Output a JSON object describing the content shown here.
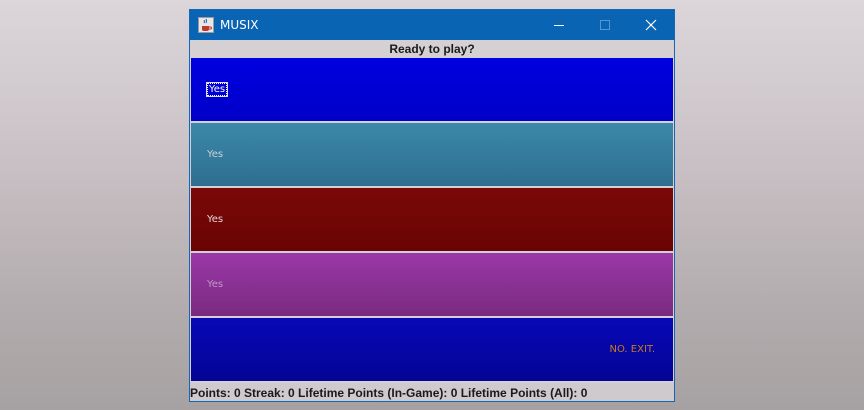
{
  "window": {
    "title": "MUSIX",
    "icon": "java-coffee-cup-icon"
  },
  "header": {
    "prompt": "Ready to play?"
  },
  "options": [
    {
      "label": "Yes",
      "color": "#0000d4",
      "focused": true
    },
    {
      "label": "Yes",
      "color": "#357c9c",
      "focused": false
    },
    {
      "label": "Yes",
      "color": "#720606",
      "focused": false
    },
    {
      "label": "Yes",
      "color": "#8a3194",
      "focused": false
    },
    {
      "label": "NO. EXIT.",
      "color": "#0606a6",
      "focused": false
    }
  ],
  "status": {
    "text": "Points: 0   Streak: 0   Lifetime Points (In-Game): 0   Lifetime Points (All): 0"
  },
  "colors": {
    "titlebar": "#0a64b4",
    "exit_text": "#c87a1a"
  }
}
